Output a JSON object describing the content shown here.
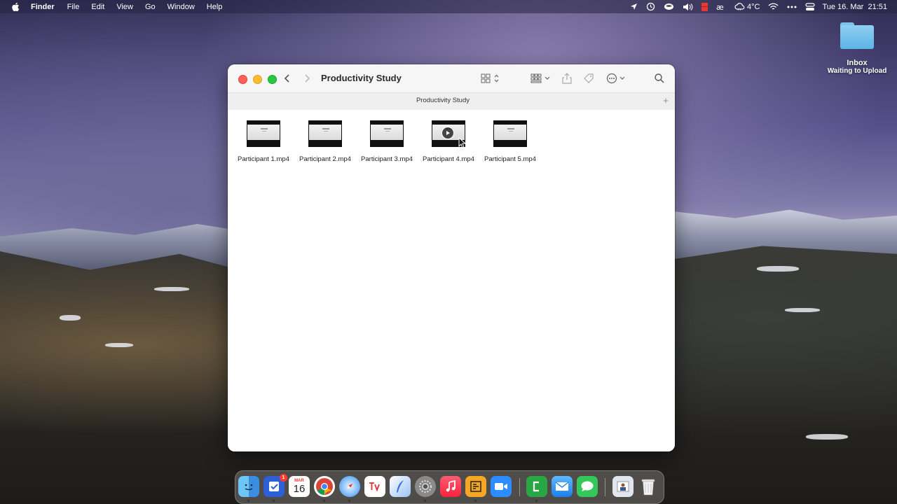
{
  "menubar": {
    "app_name": "Finder",
    "items": [
      "File",
      "Edit",
      "View",
      "Go",
      "Window",
      "Help"
    ],
    "weather": "4°C",
    "datetime": "Tue 16. Mar  21:51"
  },
  "desktop": {
    "folder_name": "Inbox",
    "folder_status": "Waiting to Upload"
  },
  "window": {
    "title": "Productivity Study",
    "tab_label": "Productivity Study",
    "add_tab": "+",
    "files": [
      {
        "name": "Participant 1.mp4"
      },
      {
        "name": "Participant 2.mp4"
      },
      {
        "name": "Participant 3.mp4"
      },
      {
        "name": "Participant 4.mp4",
        "hover_play": true
      },
      {
        "name": "Participant 5.mp4"
      }
    ]
  },
  "dock": {
    "calendar_month": "MAR",
    "calendar_day": "16",
    "reminders_badge": "1",
    "apps": [
      "Finder",
      "Tasks",
      "Calendar",
      "Chrome",
      "Safari",
      "Timing",
      "Quill",
      "System Preferences",
      "Music",
      "Sublime",
      "Zoom",
      "Numbers",
      "Mail",
      "Messages",
      "Preview",
      "Trash"
    ]
  },
  "colors": {
    "traffic_close": "#fe5f57",
    "traffic_min": "#febc2e",
    "traffic_max": "#28c840",
    "folder_blue": "#5cb4e6"
  }
}
